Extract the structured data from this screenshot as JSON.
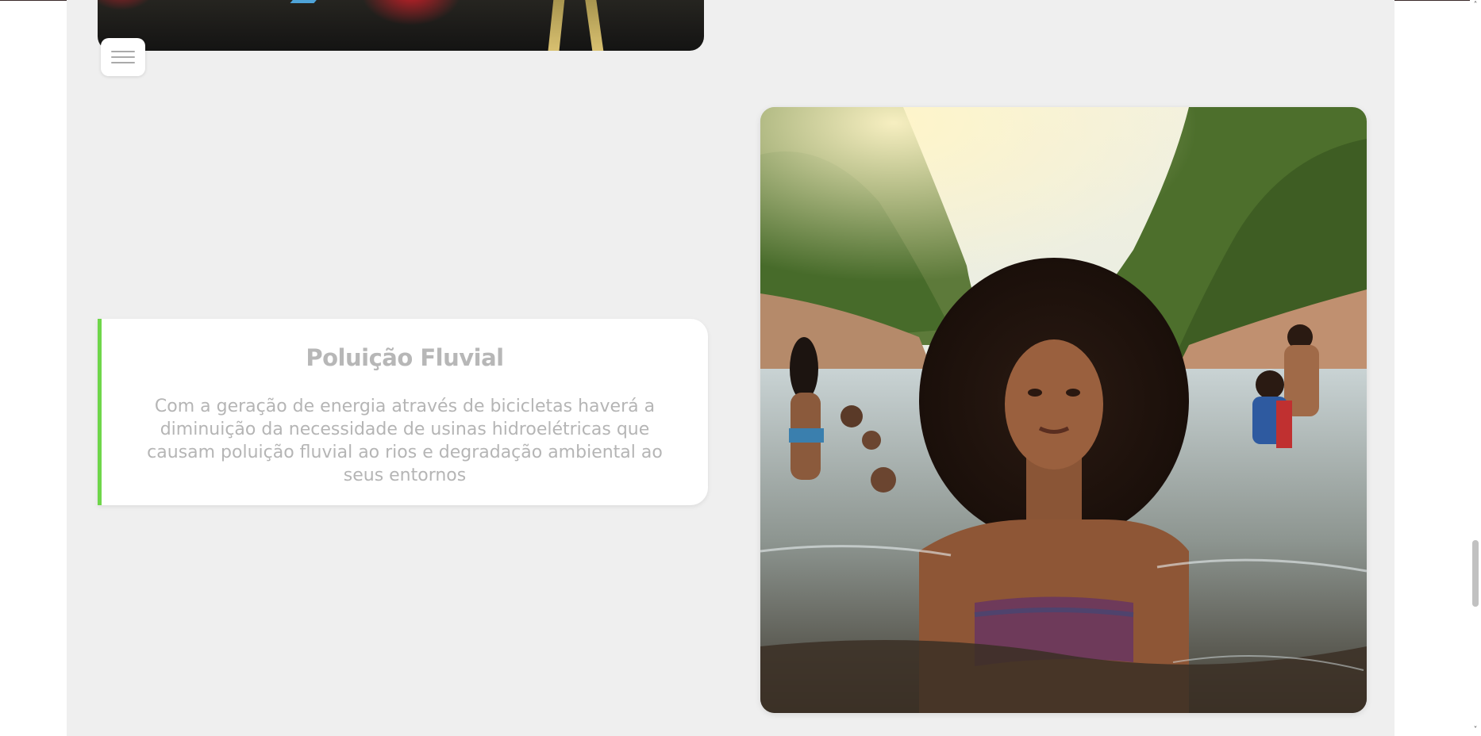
{
  "card": {
    "title": "Poluição Fluvial",
    "text": "Com a geração de energia através de bicicletas haverá a diminuição da necessidade de usinas hidroelétricas que causam poluição fluvial ao rios e degradação ambiental ao seus entornos",
    "accent_color": "#6fd64a"
  },
  "menu": {
    "icon": "hamburger-menu-icon"
  },
  "scrollbar": {
    "up_arrow": "˄",
    "down_arrow": "˅"
  },
  "colors": {
    "page_background": "#efefef",
    "card_background": "#ffffff",
    "text": "#b5b5b5"
  }
}
